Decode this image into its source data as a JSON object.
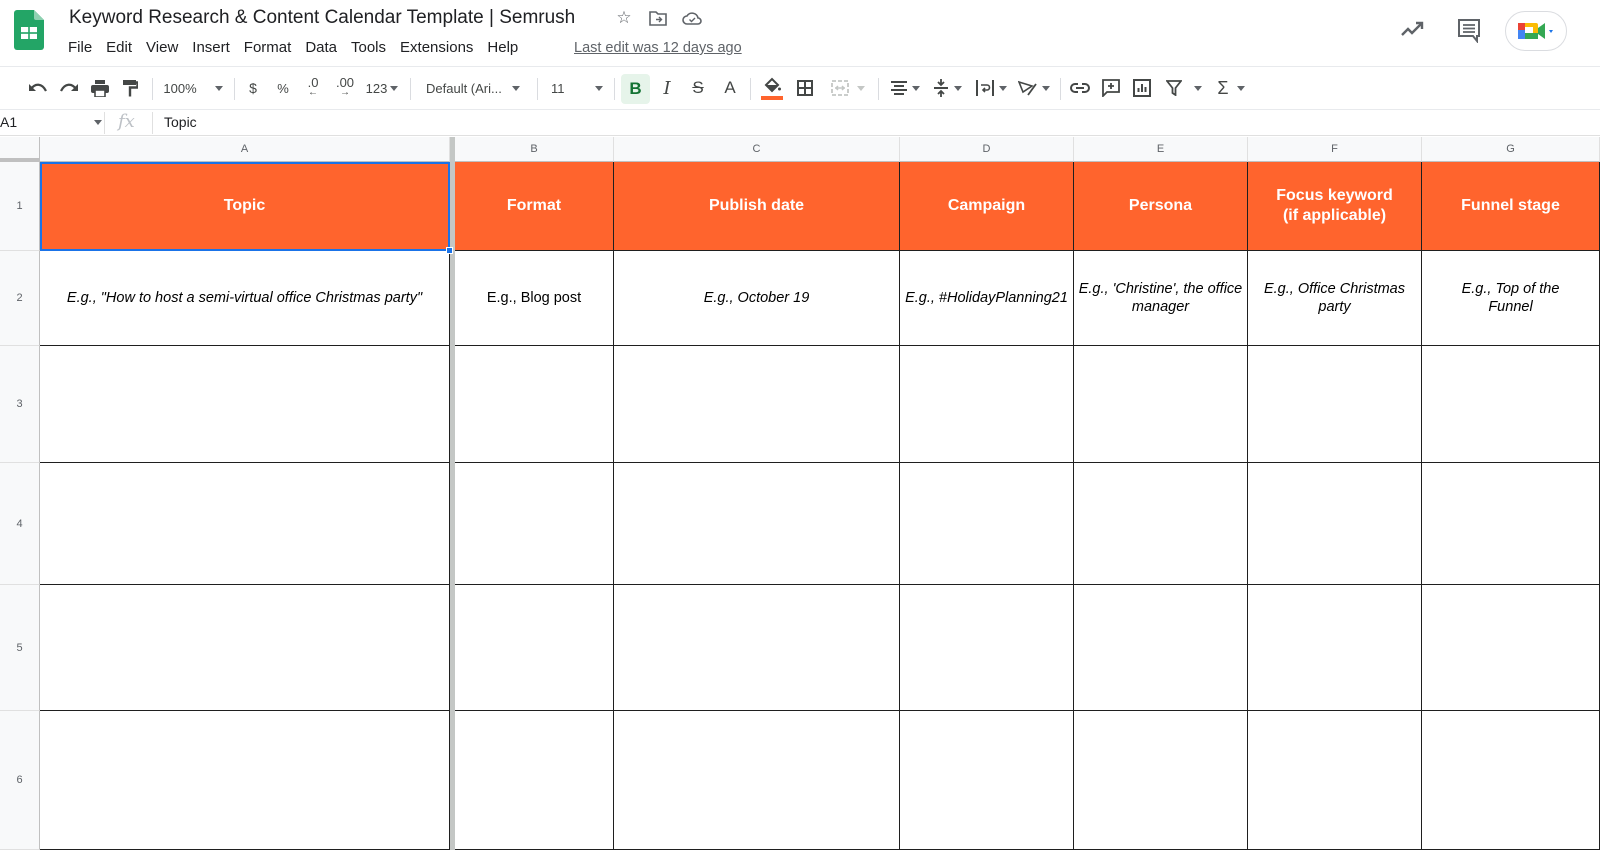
{
  "app": {
    "title": "Keyword Research & Content Calendar Template | Semrush",
    "last_edit": "Last edit was 12 days ago",
    "menu": [
      "File",
      "Edit",
      "View",
      "Insert",
      "Format",
      "Data",
      "Tools",
      "Extensions",
      "Help"
    ],
    "icons": {
      "logo": "google-sheets-logo",
      "star": "star-icon",
      "move": "move-to-folder-icon",
      "cloud": "cloud-saved-icon",
      "trend": "activity-trend-icon",
      "comments": "comments-icon",
      "meet": "google-meet-icon"
    }
  },
  "toolbar": {
    "zoom": "100%",
    "currency": "$",
    "percent": "%",
    "decrease_decimal": ".0",
    "increase_decimal": ".00",
    "more_formats": "123",
    "font": "Default (Ari...",
    "font_size": "11",
    "bold": "B",
    "italic": "I",
    "text_color": "A",
    "fill_color": "#ff642d"
  },
  "formula_bar": {
    "cell_ref": "A1",
    "fx": "fx",
    "value": "Topic"
  },
  "sheet": {
    "columns": [
      "A",
      "B",
      "C",
      "D",
      "E",
      "F",
      "G"
    ],
    "rows": [
      "1",
      "2",
      "3",
      "4",
      "5",
      "6"
    ],
    "header_color": "#ff642d",
    "selected_cell": "A1",
    "headers": [
      "Topic",
      "Format",
      "Publish date",
      "Campaign",
      "Persona",
      "Focus keyword (if applicable)",
      "Funnel stage"
    ],
    "examples": [
      "E.g., \"How to host a semi-virtual office Christmas party\"",
      "E.g., Blog post",
      "E.g., October 19",
      "E.g., #HolidayPlanning21",
      "E.g., 'Christine', the office manager",
      "E.g., Office Christmas party",
      "E.g., Top of the Funnel"
    ]
  }
}
